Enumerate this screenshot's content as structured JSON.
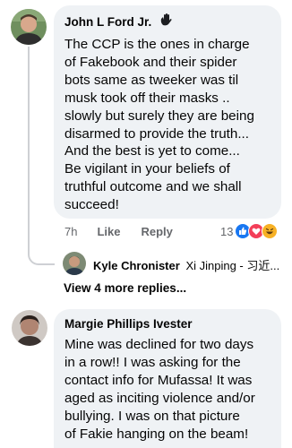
{
  "comments": [
    {
      "author": "John L Ford Jr.",
      "badge_icon": "wave-hand-icon",
      "text": "The CCP is the ones in charge\nof Fakebook and their spider\nbots same as tweeker was til\nmusk took off their masks ..\nslowly but surely they are being\ndisarmed to provide the truth...\nAnd the best is yet to come...\nBe vigilant in your beliefs of\ntruthful outcome and we shall\nsucceed!",
      "time": "7h",
      "like_label": "Like",
      "reply_label": "Reply",
      "reaction_count": "13",
      "reactions": [
        "like",
        "love",
        "haha"
      ]
    },
    {
      "author": "Margie Phillips Ivester",
      "text": "Mine was declined for two days\nin a row!!  I was asking for the\ncontact info for Mufassa! It was\naged as inciting violence and/or\nbullying.  I was on that picture\nof Fakie hanging on the beam!"
    }
  ],
  "reply_preview": {
    "author": "Kyle Chronister",
    "text": "Xi Jinping - 习近..."
  },
  "view_more_label": "View 4 more replies...",
  "colors": {
    "bubble": "#eff2f5",
    "text": "#050505",
    "meta": "#65676b",
    "like": "#1877f2",
    "love": "#f33e58",
    "haha": "#f7b125"
  }
}
